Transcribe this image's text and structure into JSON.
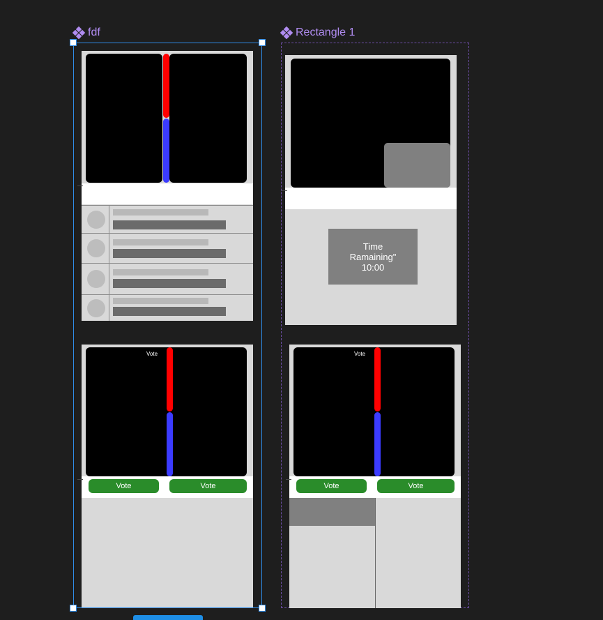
{
  "frames": [
    {
      "name": "fdf"
    },
    {
      "name": "Rectangle 1"
    }
  ],
  "timer": {
    "line1": "Time",
    "line2": "Ramaining\"",
    "line3": "10:00"
  },
  "vote": {
    "tag": "Vote",
    "button_label": "Vote"
  },
  "colors": {
    "canvas_bg": "#1e1e1e",
    "selection": "#2f8be6",
    "frame_label": "#b08cf0",
    "vote_green": "#2a8c2a",
    "bar_red": "#ff0000",
    "bar_blue": "#3b3bff"
  }
}
